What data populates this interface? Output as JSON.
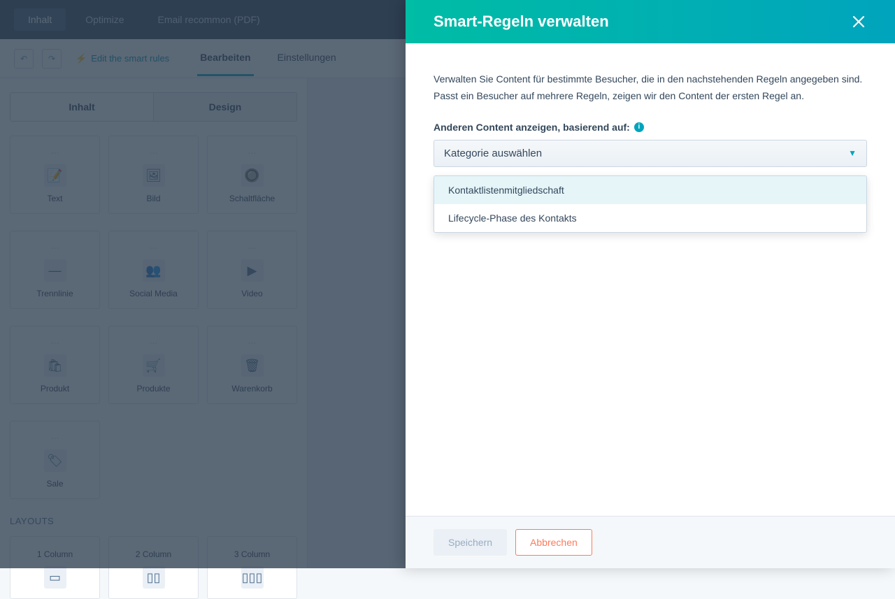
{
  "topbar": {
    "tabs": [
      "Inhalt",
      "Optimize",
      "Email recommon (PDF)"
    ]
  },
  "subbar": {
    "smart_link": "Edit the smart rules",
    "tabs": [
      "Bearbeiten",
      "Einstellungen"
    ]
  },
  "sidebar": {
    "mode_tabs": [
      "Inhalt",
      "Design"
    ],
    "modules_row1": [
      {
        "label": "Text",
        "icon": "📝"
      },
      {
        "label": "Bild",
        "icon": "🖼"
      },
      {
        "label": "Schaltfläche",
        "icon": "🔘"
      }
    ],
    "modules_row2": [
      {
        "label": "Trennlinie",
        "icon": "—"
      },
      {
        "label": "Social Media",
        "icon": "👥"
      },
      {
        "label": "Video",
        "icon": "▶"
      }
    ],
    "modules_row3": [
      {
        "label": "Produkt",
        "icon": "🛍"
      },
      {
        "label": "Produkte",
        "icon": "🛒"
      },
      {
        "label": "Warenkorb",
        "icon": "🗑"
      }
    ],
    "modules_row4": [
      {
        "label": "Sale",
        "icon": "🏷"
      }
    ],
    "layouts_heading": "Layouts",
    "layouts": [
      {
        "label": "1 Column"
      },
      {
        "label": "2 Column"
      },
      {
        "label": "3 Column"
      }
    ]
  },
  "panel": {
    "title": "Smart-Regeln verwalten",
    "intro": "Verwalten Sie Content für bestimmte Besucher, die in den nachstehenden Regeln angegeben sind. Passt ein Besucher auf mehrere Regeln, zeigen wir den Content der ersten Regel an.",
    "field_label": "Anderen Content anzeigen, basierend auf:",
    "select_placeholder": "Kategorie auswählen",
    "options": [
      "Kontaktlistenmitgliedschaft",
      "Lifecycle-Phase des Kontakts"
    ],
    "save_label": "Speichern",
    "cancel_label": "Abbrechen"
  }
}
